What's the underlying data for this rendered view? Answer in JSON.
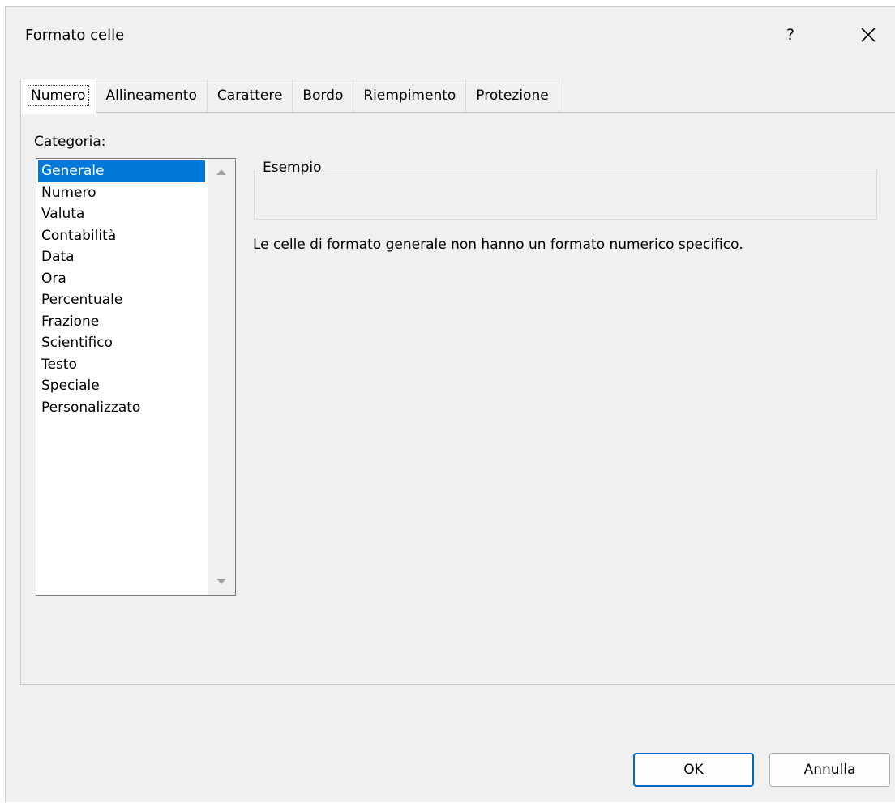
{
  "window": {
    "title": "Formato celle"
  },
  "titlebar": {
    "help_label": "?",
    "close_icon": "close-icon"
  },
  "tabs": [
    {
      "label": "Numero",
      "active": true
    },
    {
      "label": "Allineamento"
    },
    {
      "label": "Carattere"
    },
    {
      "label": "Bordo"
    },
    {
      "label": "Riempimento"
    },
    {
      "label": "Protezione"
    }
  ],
  "category": {
    "label_prefix": "C",
    "label_accel": "a",
    "label_suffix": "tegoria:",
    "items": [
      "Generale",
      "Numero",
      "Valuta",
      "Contabilità",
      "Data",
      "Ora",
      "Percentuale",
      "Frazione",
      "Scientifico",
      "Testo",
      "Speciale",
      "Personalizzato"
    ],
    "selected": "Generale"
  },
  "example": {
    "label": "Esempio",
    "value": ""
  },
  "description": "Le celle di formato generale non hanno un formato numerico specifico.",
  "buttons": {
    "ok": "OK",
    "cancel": "Annulla"
  },
  "colors": {
    "selection": "#0078d7",
    "ok_border": "#0067c0",
    "background": "#f0f0f0"
  }
}
